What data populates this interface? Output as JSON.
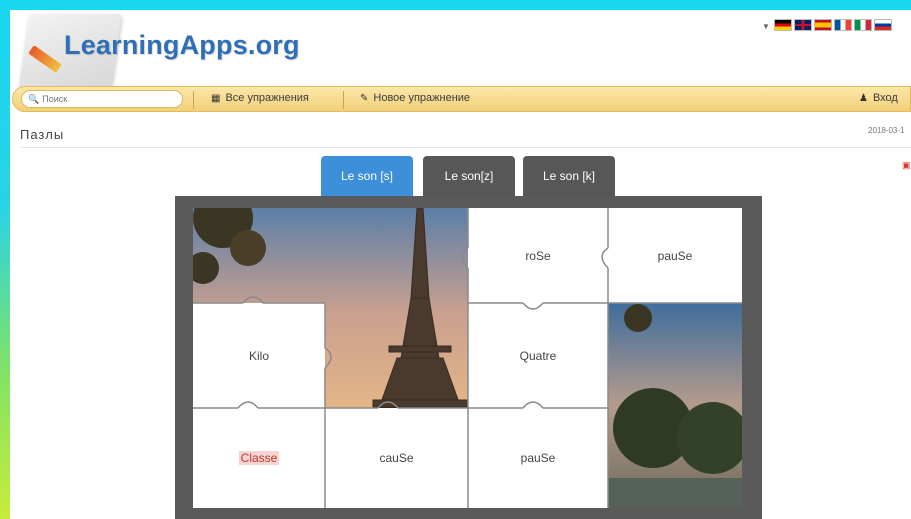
{
  "header": {
    "logo_text": "LearningApps.org",
    "language_flags": [
      {
        "name": "german-flag",
        "colors": [
          "#000000",
          "#dd0000",
          "#ffce00"
        ]
      },
      {
        "name": "english-flag",
        "colors": [
          "#012169",
          "#ffffff",
          "#c8102e"
        ]
      },
      {
        "name": "spanish-flag",
        "colors": [
          "#c60b1e",
          "#ffc400",
          "#c60b1e"
        ]
      },
      {
        "name": "french-flag",
        "colors": [
          "#0055a4",
          "#ffffff",
          "#ef4135"
        ]
      },
      {
        "name": "italian-flag",
        "colors": [
          "#009246",
          "#ffffff",
          "#ce2b37"
        ]
      },
      {
        "name": "russian-flag",
        "colors": [
          "#ffffff",
          "#0039a6",
          "#d52b1e"
        ]
      }
    ]
  },
  "navbar": {
    "search_placeholder": "Поиск",
    "all_exercises": "Все упражнения",
    "new_exercise": "Новое упражнение",
    "login": "Вход"
  },
  "page": {
    "title": "Пазлы",
    "date": "2018-03-1"
  },
  "tabs": [
    {
      "label": "Le son [s]",
      "active": true
    },
    {
      "label": "Le son[z]",
      "active": false
    },
    {
      "label": "Le son [k]",
      "active": false
    }
  ],
  "puzzle": {
    "tiles": [
      {
        "name": "tile-rose",
        "label": "roSe"
      },
      {
        "name": "tile-pause-top",
        "label": "pauSe"
      },
      {
        "name": "tile-kilo",
        "label": "Kilo"
      },
      {
        "name": "tile-quatre",
        "label": "Quatre"
      },
      {
        "name": "tile-classe",
        "label": "Classe"
      },
      {
        "name": "tile-cause",
        "label": "cauSe"
      },
      {
        "name": "tile-pause-bottom",
        "label": "pauSe"
      }
    ]
  },
  "colors": {
    "accent_tab": "#3c8fd8",
    "inactive_tab": "#575757",
    "navbar": "#f2d07a",
    "logo": "#2f6fb8"
  }
}
